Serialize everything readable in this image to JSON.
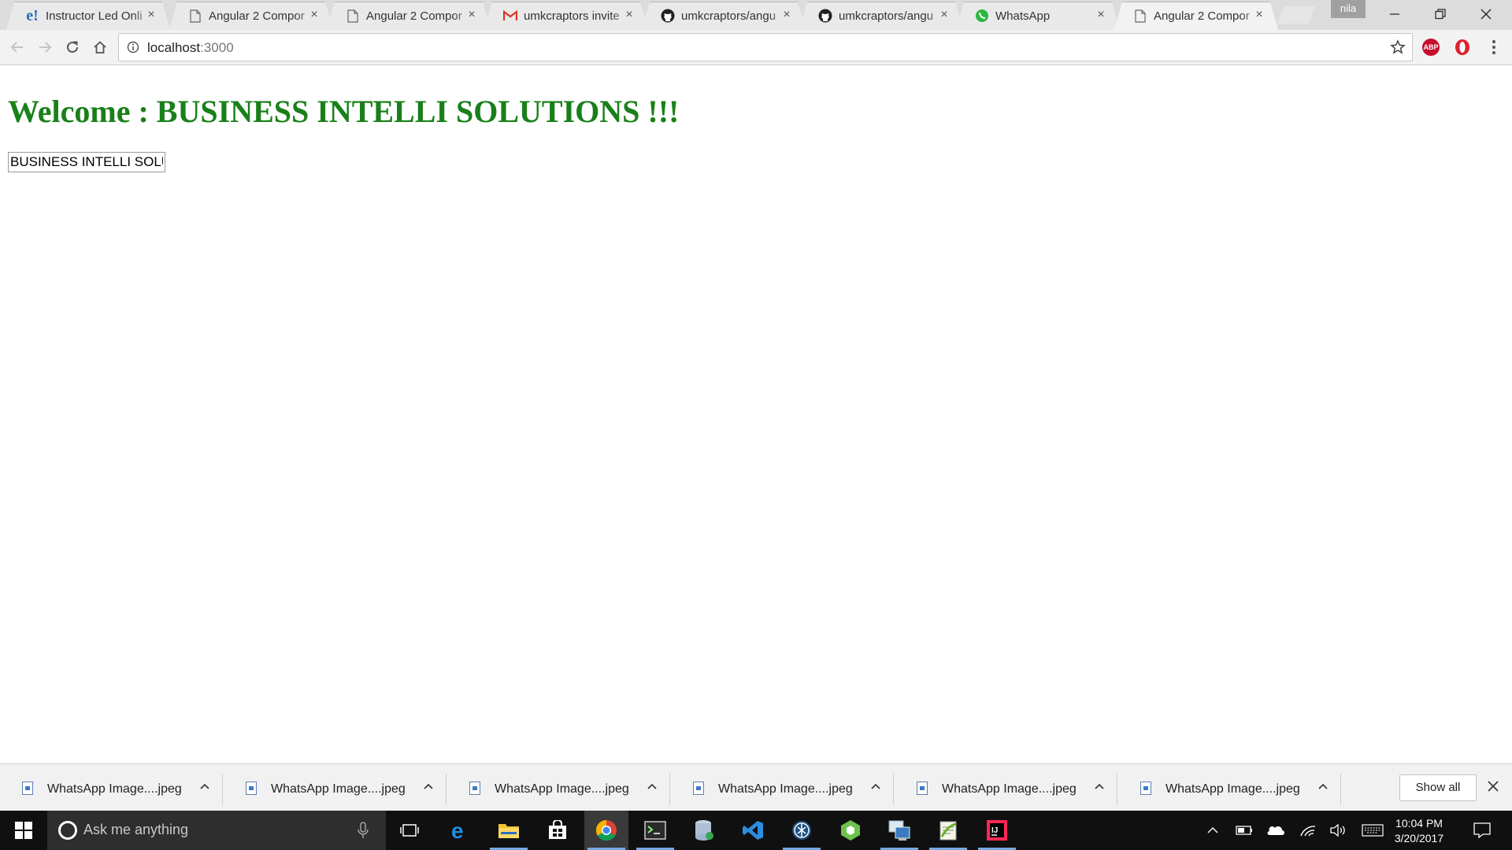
{
  "tabs": [
    {
      "title": "Instructor Led Onli",
      "icon": "edureka-icon",
      "active": false
    },
    {
      "title": "Angular 2 Compor",
      "icon": "page-icon",
      "active": false
    },
    {
      "title": "Angular 2 Compor",
      "icon": "page-icon",
      "active": false
    },
    {
      "title": "umkcraptors invite",
      "icon": "gmail-icon",
      "active": false
    },
    {
      "title": "umkcraptors/angu",
      "icon": "github-icon",
      "active": false
    },
    {
      "title": "umkcraptors/angu",
      "icon": "github-icon",
      "active": false
    },
    {
      "title": "WhatsApp",
      "icon": "whatsapp-icon",
      "active": false
    },
    {
      "title": "Angular 2 Compor",
      "icon": "page-icon",
      "active": true
    }
  ],
  "profile": {
    "name": "nila"
  },
  "omnibox": {
    "host": "localhost",
    "port": ":3000"
  },
  "extensions": [
    {
      "name": "adblock-plus-icon",
      "label": "ABP",
      "color": "#c70d2c"
    },
    {
      "name": "opera-vpn-icon",
      "label": "",
      "color": "#e0202d"
    }
  ],
  "page": {
    "heading": "Welcome : BUSINESS INTELLI SOLUTIONS !!!",
    "input_value": "BUSINESS INTELLI SOLUTIONS"
  },
  "downloads": [
    {
      "file": "WhatsApp Image....jpeg"
    },
    {
      "file": "WhatsApp Image....jpeg"
    },
    {
      "file": "WhatsApp Image....jpeg"
    },
    {
      "file": "WhatsApp Image....jpeg"
    },
    {
      "file": "WhatsApp Image....jpeg"
    },
    {
      "file": "WhatsApp Image....jpeg"
    }
  ],
  "shelf": {
    "show_all": "Show all"
  },
  "taskbar": {
    "search_placeholder": "Ask me anything",
    "apps": [
      "task-view-icon",
      "edge-icon",
      "file-explorer-icon",
      "store-icon",
      "chrome-icon",
      "terminal-icon",
      "sql-tool-icon",
      "vscode-icon",
      "git-tool-icon",
      "nodejs-icon",
      "remote-desktop-icon",
      "notepadpp-icon",
      "intellij-icon"
    ],
    "time": "10:04 PM",
    "date": "3/20/2017"
  }
}
